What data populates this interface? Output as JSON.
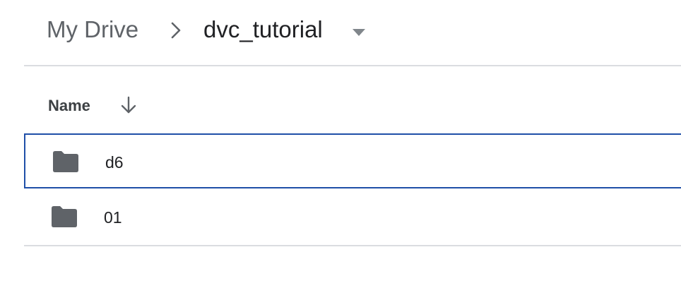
{
  "breadcrumb": {
    "root_label": "My Drive",
    "separator_icon": "chevron-right-icon",
    "current_label": "dvc_tutorial",
    "caret_icon": "caret-down-icon"
  },
  "file_list": {
    "columns": {
      "name_label": "Name",
      "sort_icon": "arrow-down-icon"
    },
    "rows": [
      {
        "name": "d6",
        "icon": "folder-icon",
        "selected": true
      },
      {
        "name": "01",
        "icon": "folder-icon",
        "selected": false
      }
    ]
  },
  "colors": {
    "selection_border": "#1f4fa8",
    "folder": "#5f6368",
    "divider": "#dadce0",
    "text_primary": "#202124",
    "text_secondary": "#5f6368"
  }
}
